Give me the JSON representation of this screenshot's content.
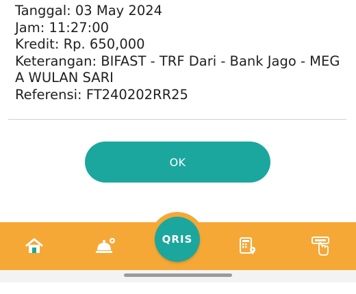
{
  "transaction": {
    "date_line": "Tanggal: 03 May 2024",
    "time_line": "Jam: 11:27:00",
    "credit_line": "Kredit: Rp. 650,000",
    "description_line_1": "Keterangan: BIFAST - TRF Dari - Bank Jago - MEG",
    "description_line_2": "A WULAN SARI",
    "reference_line": "Referensi: FT240202RR25"
  },
  "actions": {
    "ok_label": "OK"
  },
  "bottom_nav": {
    "items": [
      {
        "icon": "home-icon"
      },
      {
        "icon": "service-bell-icon"
      },
      {
        "icon": "qris-icon",
        "label": "QRIS"
      },
      {
        "icon": "bill-location-icon"
      },
      {
        "icon": "atm-cardless-icon"
      }
    ]
  },
  "colors": {
    "accent": "#1ba79d",
    "nav_background": "#f5a836",
    "icon_white": "#ffffff"
  }
}
